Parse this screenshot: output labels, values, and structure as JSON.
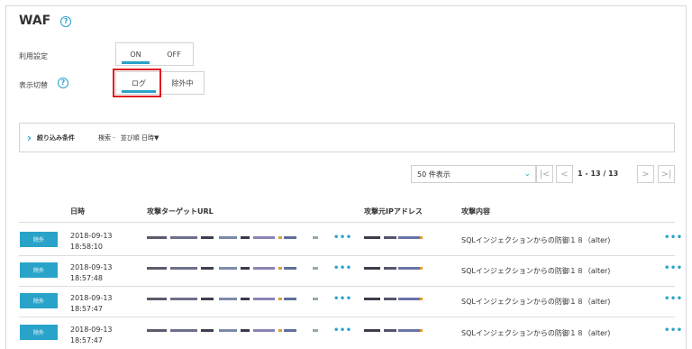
{
  "title": "WAF",
  "help_glyph": "?",
  "settings": {
    "usage_label": "利用設定",
    "usage_options": [
      "ON",
      "OFF"
    ],
    "usage_selected": "ON",
    "display_label": "表示切替",
    "display_options": [
      "ログ",
      "除外中"
    ],
    "display_selected": "ログ"
  },
  "filter": {
    "toggle_icon": "chevron-right-icon",
    "title": "絞り込み条件",
    "search_text": "検索 -",
    "sort_text": "並び順 日時▼"
  },
  "pagination": {
    "per_page": "50 件表示",
    "info": "1 - 13 / 13",
    "first": "|<",
    "prev": "<",
    "next": ">",
    "last": ">|"
  },
  "table": {
    "columns": [
      "日時",
      "攻撃ターゲットURL",
      "攻撃元IPアドレス",
      "攻撃内容"
    ],
    "rows": [
      {
        "badge": "除外",
        "date": "2018-09-13",
        "time": "18:58:10",
        "more": "•••",
        "attack": "SQLインジェクションからの防御１８（alter)",
        "more2": "•••"
      },
      {
        "badge": "除外",
        "date": "2018-09-13",
        "time": "18:57:48",
        "more": "•••",
        "attack": "SQLインジェクションからの防御１８（alter)",
        "more2": "•••"
      },
      {
        "badge": "除外",
        "date": "2018-09-13",
        "time": "18:57:47",
        "more": "•••",
        "attack": "SQLインジェクションからの防御１８（alter)",
        "more2": "•••"
      },
      {
        "badge": "除外",
        "date": "2018-09-13",
        "time": "18:57:47",
        "more": "•••",
        "attack": "SQLインジェクションからの防御１８（alter)",
        "more2": "•••"
      }
    ]
  },
  "colors": {
    "accent": "#29a3c9",
    "highlight": "#e11b22"
  }
}
